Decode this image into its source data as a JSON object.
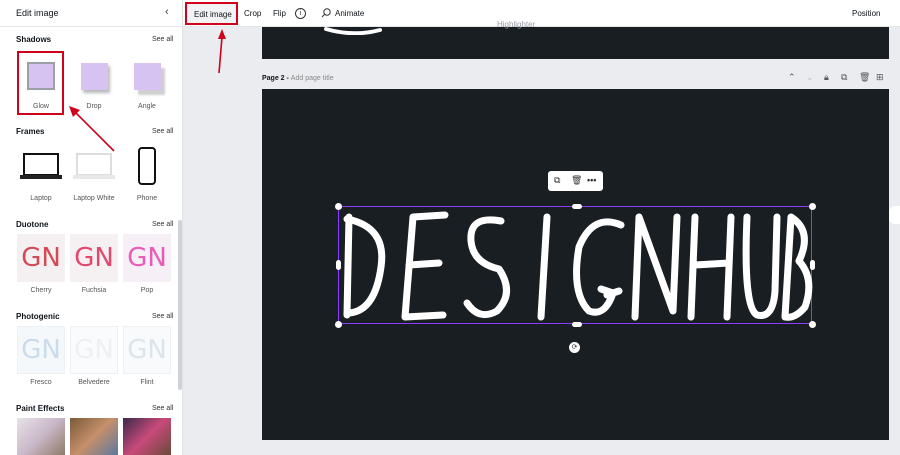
{
  "panel": {
    "title": "Edit image",
    "close": "‹",
    "sections": {
      "shadows": {
        "title": "Shadows",
        "see_all": "See all",
        "items": [
          {
            "label": "Glow"
          },
          {
            "label": "Drop"
          },
          {
            "label": "Angle"
          }
        ]
      },
      "frames": {
        "title": "Frames",
        "see_all": "See all",
        "items": [
          {
            "label": "Laptop"
          },
          {
            "label": "Laptop White"
          },
          {
            "label": "Phone"
          }
        ]
      },
      "duotone": {
        "title": "Duotone",
        "see_all": "See all",
        "items": [
          {
            "label": "Cherry",
            "glyph": "GN",
            "color": "#d14a55"
          },
          {
            "label": "Fuchsia",
            "glyph": "GN",
            "color": "#e2486e"
          },
          {
            "label": "Pop",
            "glyph": "GN",
            "color": "#e85bb8"
          }
        ]
      },
      "photogenic": {
        "title": "Photogenic",
        "see_all": "See all",
        "items": [
          {
            "label": "Fresco",
            "glyph": "GN"
          },
          {
            "label": "Belvedere",
            "glyph": "GN"
          },
          {
            "label": "Flint",
            "glyph": "GN"
          }
        ]
      },
      "paint_effects": {
        "title": "Paint Effects",
        "see_all": "See all"
      }
    }
  },
  "toolbar": {
    "edit_image": "Edit image",
    "crop": "Crop",
    "flip": "Flip",
    "info": "i",
    "animate": "Animate",
    "position": "Position"
  },
  "canvas": {
    "top_page_text": "Highlighter",
    "page_title": "Page 2 - ",
    "page_title_placeholder": "Add page title",
    "design_text": "DESIGN HUB"
  },
  "colors": {
    "accent": "#8b3dff",
    "highlight": "#d0011b",
    "canvas_bg": "#191e23",
    "shadow_swatch": "#d6c3f2"
  }
}
